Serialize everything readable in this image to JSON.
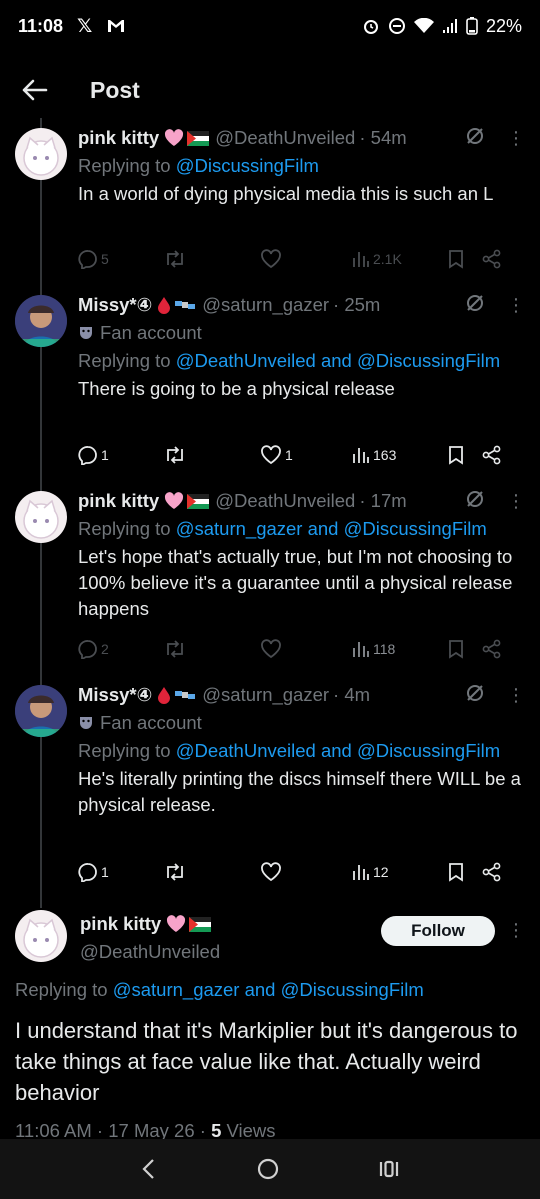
{
  "status": {
    "time": "11:08",
    "battery": "22%"
  },
  "header": {
    "title": "Post"
  },
  "tweets": [
    {
      "name": "pink kitty",
      "handle": "@DeathUnveiled",
      "time": "· 54m",
      "replying_prefix": "Replying to ",
      "replying_to": "@DiscussingFilm",
      "text": "In a world of dying physical media this is such an L",
      "replies": "5",
      "likes": "",
      "views": "2.1K"
    },
    {
      "name": "Missy*④",
      "handle": "@saturn_gazer",
      "time": "· 25m",
      "fan": "Fan account",
      "replying_prefix": "Replying to ",
      "replying_to": "@DeathUnveiled and @DiscussingFilm",
      "text": "There is going to be a physical release",
      "replies": "1",
      "likes": "1",
      "views": "163"
    },
    {
      "name": "pink kitty",
      "handle": "@DeathUnveiled",
      "time": "· 17m",
      "replying_prefix": "Replying to ",
      "replying_to": "@saturn_gazer and @DiscussingFilm",
      "text": "Let's hope that's actually true, but I'm not choosing to 100% believe it's a guarantee until a physical release happens",
      "replies": "2",
      "likes": "",
      "views": "118"
    },
    {
      "name": "Missy*④",
      "handle": "@saturn_gazer",
      "time": "· 4m",
      "fan": "Fan account",
      "replying_prefix": "Replying to ",
      "replying_to": "@DeathUnveiled and @DiscussingFilm",
      "text": "He's literally printing the discs himself there WILL be a physical release.",
      "replies": "1",
      "likes": "",
      "views": "12"
    }
  ],
  "main": {
    "name": "pink kitty",
    "handle": "@DeathUnveiled",
    "follow": "Follow",
    "replying_prefix": "Replying to ",
    "replying_to": "@saturn_gazer and @DiscussingFilm",
    "text": "I understand that it's Markiplier but it's dangerous to take things at face value like that. Actually weird behavior",
    "timestamp": "11:06 AM · 17 May 26 · ",
    "views_count": "5",
    "views_label": " Views"
  },
  "colors": {
    "accent": "#1d9bf0",
    "background": "#000000"
  }
}
